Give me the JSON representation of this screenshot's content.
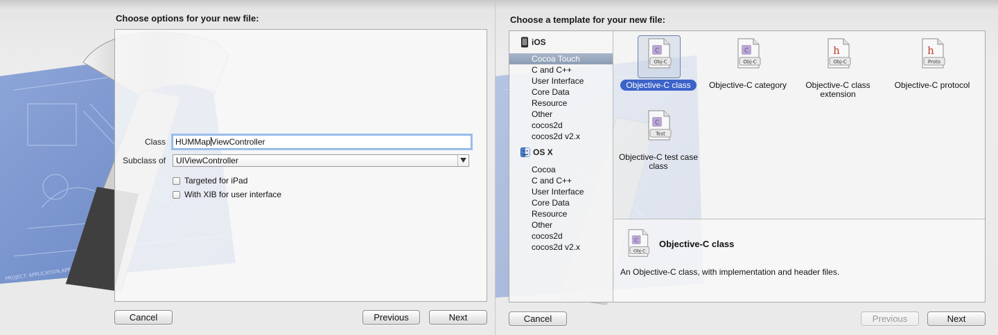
{
  "left": {
    "heading": "Choose options for your new file:",
    "fields": {
      "class_label": "Class",
      "class_value_before_caret": "HUMMap",
      "class_value_after_caret": "ViewController",
      "subclass_label": "Subclass of",
      "subclass_value": "UIViewController"
    },
    "checkboxes": {
      "ipad_label": "Targeted for iPad",
      "ipad_checked": false,
      "xib_label": "With XIB for user interface",
      "xib_checked": false
    },
    "buttons": {
      "cancel": "Cancel",
      "previous": "Previous",
      "next": "Next"
    }
  },
  "right": {
    "heading": "Choose a template for your new file:",
    "sidebar": {
      "groups": [
        {
          "title": "iOS",
          "icon": "iphone-icon",
          "items": [
            {
              "label": "Cocoa Touch",
              "selected": true
            },
            {
              "label": "C and C++"
            },
            {
              "label": "User Interface"
            },
            {
              "label": "Core Data"
            },
            {
              "label": "Resource"
            },
            {
              "label": "Other"
            },
            {
              "label": "cocos2d"
            },
            {
              "label": "cocos2d v2.x"
            }
          ]
        },
        {
          "title": "OS X",
          "icon": "finder-icon",
          "items": [
            {
              "label": "Cocoa"
            },
            {
              "label": "C and C++"
            },
            {
              "label": "User Interface"
            },
            {
              "label": "Core Data"
            },
            {
              "label": "Resource"
            },
            {
              "label": "Other"
            },
            {
              "label": "cocos2d"
            },
            {
              "label": "cocos2d v2.x"
            }
          ]
        }
      ]
    },
    "templates": [
      {
        "label": "Objective-C class",
        "badge": "Obj-C",
        "kind": "objc-file-icon",
        "selected": true
      },
      {
        "label": "Objective-C category",
        "badge": "Obj-C",
        "kind": "objc-file-icon"
      },
      {
        "label": "Objective-C class extension",
        "badge": "Obj-C",
        "kind": "header-file-icon"
      },
      {
        "label": "Objective-C protocol",
        "badge": "Proto",
        "kind": "header-file-icon"
      },
      {
        "label": "Objective-C test case class",
        "badge": "Test",
        "kind": "objc-file-icon"
      }
    ],
    "detail": {
      "title": "Objective-C class",
      "badge": "Obj-C",
      "description": "An Objective-C class, with implementation and header files."
    },
    "buttons": {
      "cancel": "Cancel",
      "previous": "Previous",
      "next": "Next",
      "previous_enabled": false
    }
  },
  "colors": {
    "selection_blue": "#3c63c9",
    "sidebar_selection": "#8c9db4",
    "blueprint": "#5b7fc4",
    "focus_ring": "#9cc0ee"
  }
}
